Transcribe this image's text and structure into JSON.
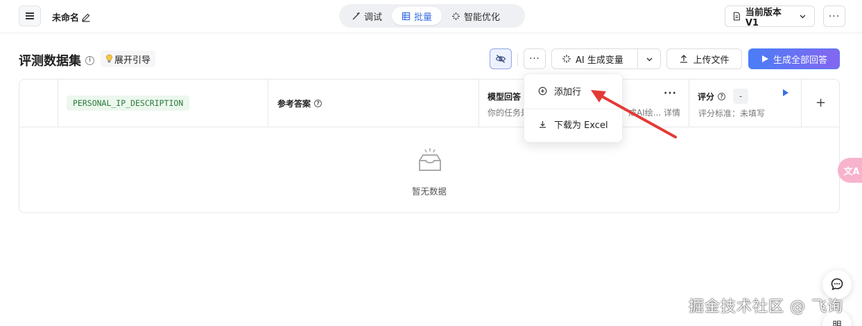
{
  "header": {
    "title": "未命名",
    "modes": [
      {
        "label": "调试"
      },
      {
        "label": "批量",
        "active": true
      },
      {
        "label": "智能优化"
      }
    ],
    "version_label": "当前版本V1",
    "more_label": "···"
  },
  "section": {
    "title": "评测数据集",
    "guide_label": "展开引导"
  },
  "toolbar": {
    "more_label": "···",
    "ai_generate_label": "AI 生成变量",
    "upload_label": "上传文件",
    "generate_all_label": "生成全部回答"
  },
  "table": {
    "columns": [
      {
        "variable": "PERSONAL_IP_DESCRIPTION"
      },
      {
        "label": "参考答案"
      },
      {
        "label": "模型回答",
        "subtitle": "你的任务是",
        "desc": "成AI绘... 详情"
      },
      {
        "label": "评分",
        "score": "-",
        "subtitle": "评分标准：未填写"
      }
    ],
    "add_column_label": "+",
    "empty_text": "暂无数据"
  },
  "dropdown": {
    "items": [
      {
        "label": "添加行",
        "icon": "plus-circle-icon"
      },
      {
        "label": "下载为 Excel",
        "icon": "download-icon"
      }
    ]
  },
  "floating": {
    "translate_label": "文A",
    "extra_label": "明"
  },
  "watermark": "掘金技术社区 @ 飞询",
  "colors": {
    "accent": "#3a6ee8",
    "variable_chip_bg": "#ecf7ee",
    "variable_chip_text": "#2b7a3d",
    "arrow": "#e53935",
    "primary_gradient_start": "#4a7df7",
    "primary_gradient_end": "#8566f0"
  }
}
